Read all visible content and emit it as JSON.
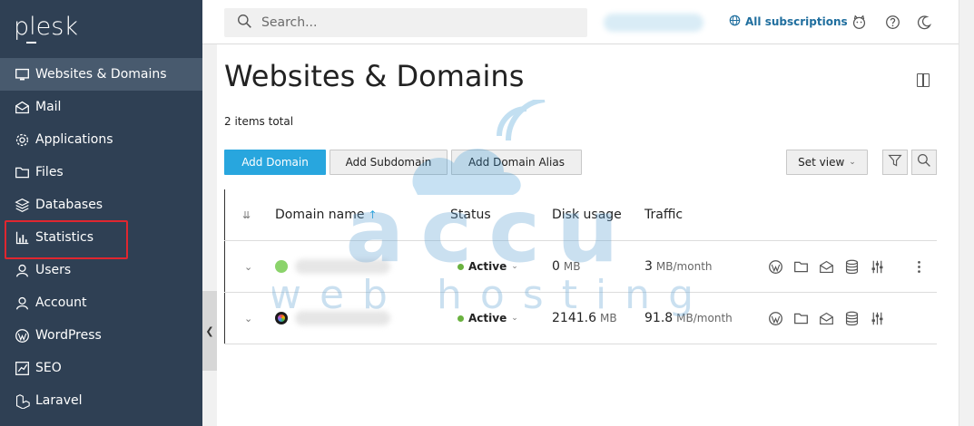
{
  "brand": {
    "logo_text": "plesk"
  },
  "sidebar": {
    "items": [
      {
        "label": "Websites & Domains",
        "icon": "monitor-icon",
        "active": true
      },
      {
        "label": "Mail",
        "icon": "envelope-icon"
      },
      {
        "label": "Applications",
        "icon": "gear-icon"
      },
      {
        "label": "Files",
        "icon": "folder-icon"
      },
      {
        "label": "Databases",
        "icon": "layers-icon"
      },
      {
        "label": "Statistics",
        "icon": "bar-chart-icon"
      },
      {
        "label": "Users",
        "icon": "user-icon"
      },
      {
        "label": "Account",
        "icon": "account-icon"
      },
      {
        "label": "WordPress",
        "icon": "wordpress-icon"
      },
      {
        "label": "SEO",
        "icon": "seo-chart-icon"
      },
      {
        "label": "Laravel",
        "icon": "laravel-icon"
      }
    ]
  },
  "topbar": {
    "search_placeholder": "Search...",
    "subscriptions_label": "All subscriptions"
  },
  "main": {
    "title": "Websites & Domains",
    "items_total": "2 items total",
    "buttons": {
      "add_domain": "Add Domain",
      "add_subdomain": "Add Subdomain",
      "add_domain_alias": "Add Domain Alias",
      "set_view": "Set view"
    },
    "table": {
      "headers": {
        "domain_name": "Domain name",
        "sort_arrow": "↑",
        "status": "Status",
        "disk_usage": "Disk usage",
        "traffic": "Traffic"
      },
      "rows": [
        {
          "status": "Active",
          "disk_value": "0",
          "disk_unit": "MB",
          "traffic_value": "3",
          "traffic_unit": "MB/month",
          "favicon_color": "#8bd36b"
        },
        {
          "status": "Active",
          "disk_value": "2141.6",
          "disk_unit": "MB",
          "traffic_value": "91.8",
          "traffic_unit": "MB/month",
          "favicon_color": "#1b1b1b"
        }
      ]
    }
  },
  "watermark": {
    "line1": "accu",
    "line2": "web hosting"
  },
  "colors": {
    "sidebar_bg": "#2f4054",
    "sidebar_active": "#485a6e",
    "primary_button": "#28a6de",
    "status_active": "#6ab23f",
    "link": "#1f6e9e",
    "highlight_border": "#e0262f"
  }
}
